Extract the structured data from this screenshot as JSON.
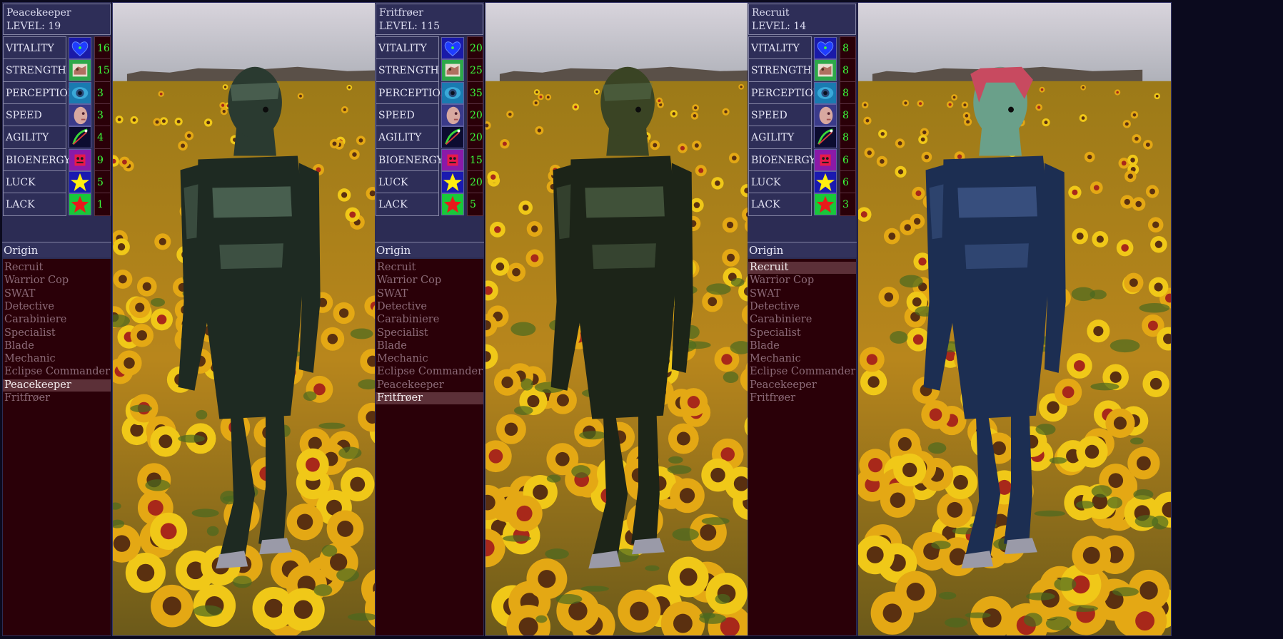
{
  "stat_labels": [
    "VITALITY",
    "STRENGTH",
    "PERCEPTION",
    "SPEED",
    "AGILITY",
    "BIOENERGY",
    "LUCK",
    "LACK"
  ],
  "stat_icons": [
    "heart-icon",
    "strength-icon",
    "perception-eye-icon",
    "speed-face-icon",
    "agility-icon",
    "bioenergy-icon",
    "luck-star-icon",
    "lack-star-icon"
  ],
  "origin_label": "Origin",
  "origins": [
    "Recruit",
    "Warrior Cop",
    "SWAT",
    "Detective",
    "Carabiniere",
    "Specialist",
    "Blade",
    "Mechanic",
    "Eclipse Commander",
    "Peacekeeper",
    "Fritfrøer"
  ],
  "panels": [
    {
      "name": "Peacekeeper",
      "level": "LEVEL: 19",
      "stats": [
        "16",
        "15",
        "3",
        "3",
        "4",
        "9",
        "5",
        "1"
      ],
      "selected_origin": "Peacekeeper",
      "character_colors": {
        "suit": "#1e2a22",
        "highlight": "#6c8a74",
        "head": "#2a3a30"
      }
    },
    {
      "name": "Fritfrøer",
      "level": "LEVEL: 115",
      "stats": [
        "20",
        "25",
        "35",
        "20",
        "20",
        "15",
        "20",
        "5"
      ],
      "selected_origin": "Fritfrøer",
      "character_colors": {
        "suit": "#1c2418",
        "highlight": "#5e7656",
        "head": "#3a4424"
      }
    },
    {
      "name": "Recruit",
      "level": "LEVEL: 14",
      "stats": [
        "8",
        "8",
        "8",
        "8",
        "8",
        "6",
        "6",
        "3"
      ],
      "selected_origin": "Recruit",
      "character_colors": {
        "suit": "#1c2e52",
        "highlight": "#4e6aa0",
        "head": "#6aa08a",
        "hair": "#c84a60"
      }
    }
  ],
  "colors": {
    "panel_bg": "#2c2c54",
    "panel_border": "#8484a4",
    "value_bg": "#2a0008",
    "value_text": "#3cff3c",
    "origin_selected_bg": "#5c3038",
    "origin_text": "#8c6a78",
    "sky": "#c8c4cc",
    "field": "#b88a18"
  }
}
